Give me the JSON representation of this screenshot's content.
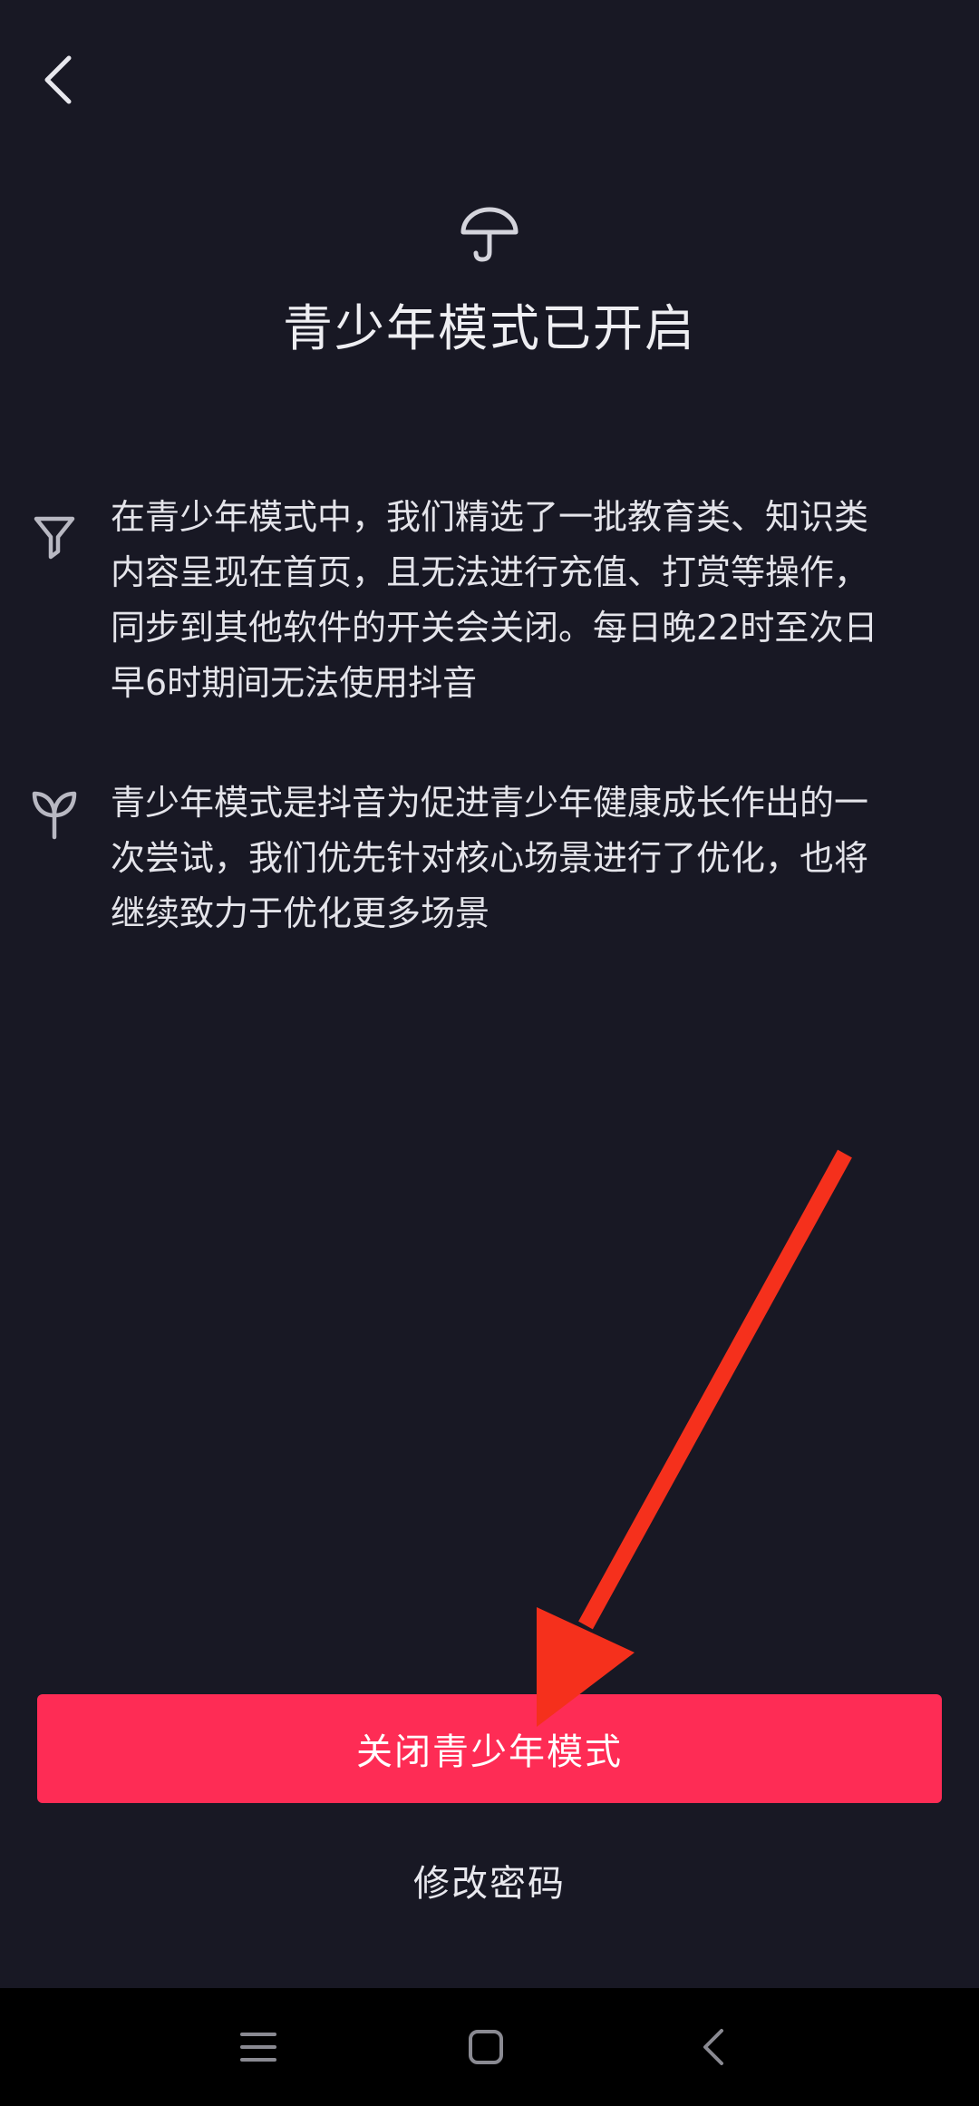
{
  "header": {
    "back_icon": "chevron-left-icon"
  },
  "hero": {
    "icon": "umbrella-icon",
    "title": "青少年模式已开启"
  },
  "info": [
    {
      "icon": "filter-icon",
      "lines": [
        "在青少年模式中，我们精选了一批教育类、知识类",
        "内容呈现在首页，且无法进行充值、打赏等操作，",
        "同步到其他软件的开关会关闭。每日晚22时至次日",
        "早6时期间无法使用抖音"
      ]
    },
    {
      "icon": "sprout-icon",
      "lines": [
        "青少年模式是抖音为促进青少年健康成长作出的一",
        "次尝试，我们优先针对核心场景进行了优化，也将",
        "继续致力于优化更多场景"
      ]
    }
  ],
  "actions": {
    "close_mode_label": "关闭青少年模式",
    "change_password_label": "修改密码"
  },
  "colors": {
    "background": "#181824",
    "accent": "#fe2c55",
    "annotation_arrow": "#f5301c",
    "nav_bar": "#000000"
  },
  "system_nav": {
    "menu_icon": "menu-icon",
    "home_icon": "home-square-icon",
    "back_icon": "back-chevron-icon"
  }
}
